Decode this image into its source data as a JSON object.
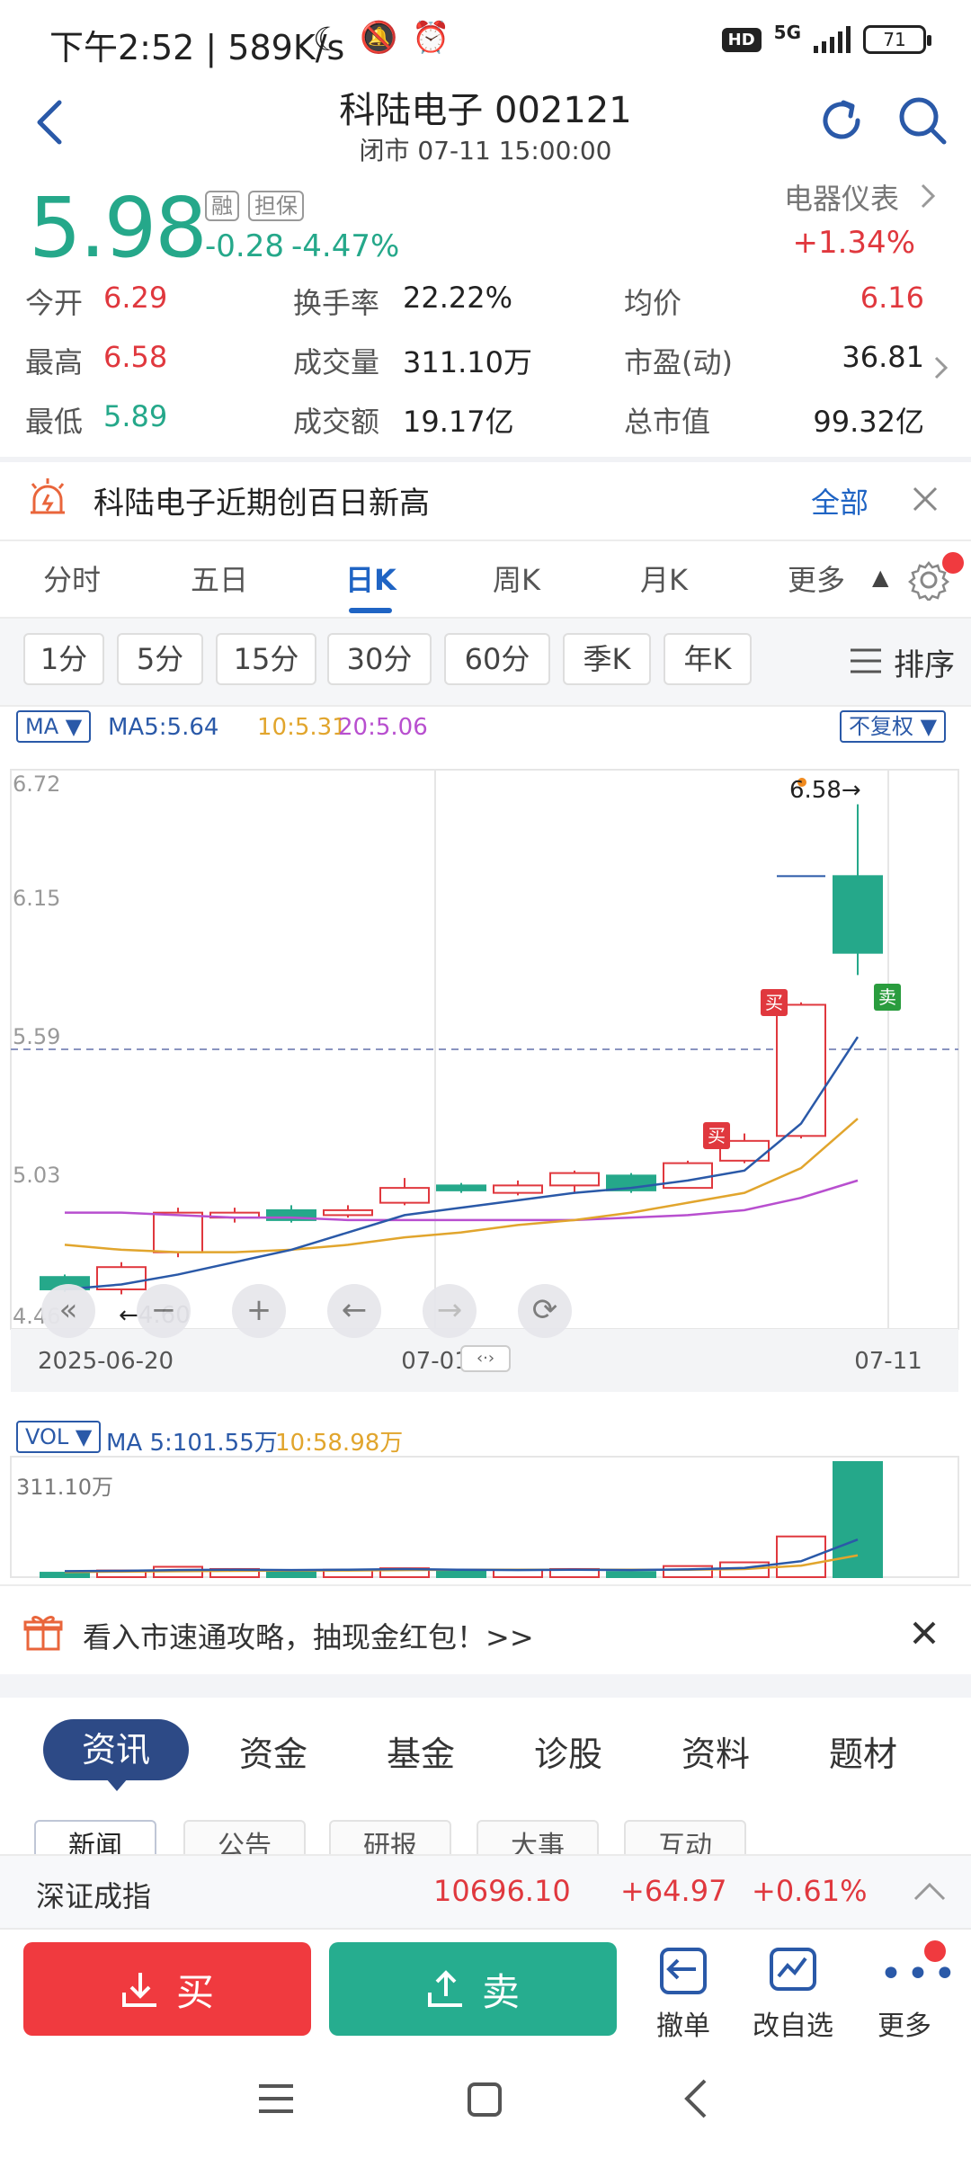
{
  "status_bar": {
    "time_speed": "下午2:52 | 589K/s",
    "signal": "5G",
    "battery": "71"
  },
  "header": {
    "title": "科陆电子 002121",
    "subtitle": "闭市 07-11 15:00:00"
  },
  "quote": {
    "price": "5.98",
    "tag_margin": "融",
    "tag_guarantee": "担保",
    "change": "-0.28",
    "change_pct": "-4.47%",
    "sector": "电器仪表",
    "sector_pct": "+1.34%"
  },
  "stats": {
    "open_label": "今开",
    "open": "6.29",
    "high_label": "最高",
    "high": "6.58",
    "low_label": "最低",
    "low": "5.89",
    "turnover_rate_label": "换手率",
    "turnover_rate": "22.22%",
    "volume_label": "成交量",
    "volume": "311.10万",
    "amount_label": "成交额",
    "amount": "19.17亿",
    "avg_label": "均价",
    "avg": "6.16",
    "pe_label": "市盈(动)",
    "pe": "36.81",
    "mktcap_label": "总市值",
    "mktcap": "99.32亿"
  },
  "notice": {
    "text": "科陆电子近期创百日新高",
    "all_label": "全部"
  },
  "period_tabs": [
    "分时",
    "五日",
    "日K",
    "周K",
    "月K",
    "更多"
  ],
  "minute_chips": [
    "1分",
    "5分",
    "15分",
    "30分",
    "60分",
    "季K",
    "年K"
  ],
  "sort_label": "排序",
  "chart_header": {
    "ma_select": "MA",
    "ma5": "MA5:5.64",
    "ma10": "10:5.31",
    "ma20": "20:5.06",
    "adjust": "不复权"
  },
  "chart_labels": {
    "high_marker": "6.58→",
    "low_marker": "←4.60",
    "buy_tag": "买",
    "sell_tag": "卖"
  },
  "chart_data": {
    "type": "candlestick",
    "y_ticks": [
      "6.72",
      "6.15",
      "5.59",
      "5.03",
      "4.46"
    ],
    "ylim": [
      4.46,
      6.72
    ],
    "dashed_line": 5.59,
    "x_ticks": [
      "2025-06-20",
      "07-01",
      "07-11"
    ],
    "candles": [
      {
        "open": 4.67,
        "close": 4.62,
        "high": 4.68,
        "low": 4.61
      },
      {
        "open": 4.62,
        "close": 4.71,
        "high": 4.73,
        "low": 4.6
      },
      {
        "open": 4.77,
        "close": 4.93,
        "high": 4.95,
        "low": 4.75
      },
      {
        "open": 4.91,
        "close": 4.93,
        "high": 4.95,
        "low": 4.89
      },
      {
        "open": 4.94,
        "close": 4.9,
        "high": 4.96,
        "low": 4.89
      },
      {
        "open": 4.92,
        "close": 4.94,
        "high": 4.96,
        "low": 4.91
      },
      {
        "open": 4.97,
        "close": 5.03,
        "high": 5.07,
        "low": 4.96
      },
      {
        "open": 5.04,
        "close": 5.02,
        "high": 5.05,
        "low": 5.01
      },
      {
        "open": 5.01,
        "close": 5.04,
        "high": 5.06,
        "low": 5.0
      },
      {
        "open": 5.04,
        "close": 5.09,
        "high": 5.1,
        "low": 5.01
      },
      {
        "open": 5.08,
        "close": 5.02,
        "high": 5.09,
        "low": 5.01
      },
      {
        "open": 5.03,
        "close": 5.13,
        "high": 5.14,
        "low": 5.03
      },
      {
        "open": 5.14,
        "close": 5.22,
        "high": 5.25,
        "low": 5.13
      },
      {
        "open": 5.24,
        "close": 5.77,
        "high": 5.78,
        "low": 5.23
      },
      {
        "open": 6.29,
        "close": 5.98,
        "high": 6.58,
        "low": 5.89
      }
    ],
    "ma5": [
      4.62,
      4.64,
      4.68,
      4.73,
      4.78,
      4.85,
      4.92,
      4.95,
      4.98,
      5.01,
      5.03,
      5.06,
      5.1,
      5.29,
      5.64
    ],
    "ma10": [
      4.8,
      4.78,
      4.77,
      4.77,
      4.78,
      4.8,
      4.83,
      4.85,
      4.88,
      4.9,
      4.93,
      4.97,
      5.01,
      5.11,
      5.31
    ],
    "ma20": [
      4.93,
      4.93,
      4.92,
      4.91,
      4.91,
      4.9,
      4.9,
      4.9,
      4.9,
      4.9,
      4.91,
      4.92,
      4.94,
      4.99,
      5.06
    ]
  },
  "vol_header": {
    "select": "VOL",
    "ma5": "MA 5:101.55万",
    "ma10": "10:58.98万",
    "max_label": "311.10万"
  },
  "vol_data": {
    "values": [
      12,
      18,
      28,
      22,
      14,
      20,
      24,
      16,
      20,
      22,
      14,
      30,
      40,
      110,
      311.1
    ],
    "ma5": [
      16,
      17,
      19,
      20,
      19,
      20,
      22,
      20,
      19,
      20,
      19,
      21,
      25,
      43,
      101.55
    ],
    "ma10": [
      14,
      15,
      16,
      17,
      18,
      18,
      19,
      20,
      20,
      20,
      20,
      20,
      22,
      31,
      58.98
    ]
  },
  "promo": {
    "text": "看入市速通攻略，抽现金红包！>>"
  },
  "bottom_tabs": [
    "资讯",
    "资金",
    "基金",
    "诊股",
    "资料",
    "题材"
  ],
  "sub_tabs": [
    "新闻",
    "公告",
    "研报",
    "大事",
    "互动"
  ],
  "index_bar": {
    "name": "深证成指",
    "value": "10696.10",
    "change": "+64.97",
    "pct": "+0.61%"
  },
  "actions": {
    "buy": "买",
    "sell": "卖",
    "cancel": "撤单",
    "edit_watch": "改自选",
    "more": "更多"
  },
  "colors": {
    "up": "#e0383e",
    "down": "#25a88a",
    "accent": "#1f64c4"
  }
}
